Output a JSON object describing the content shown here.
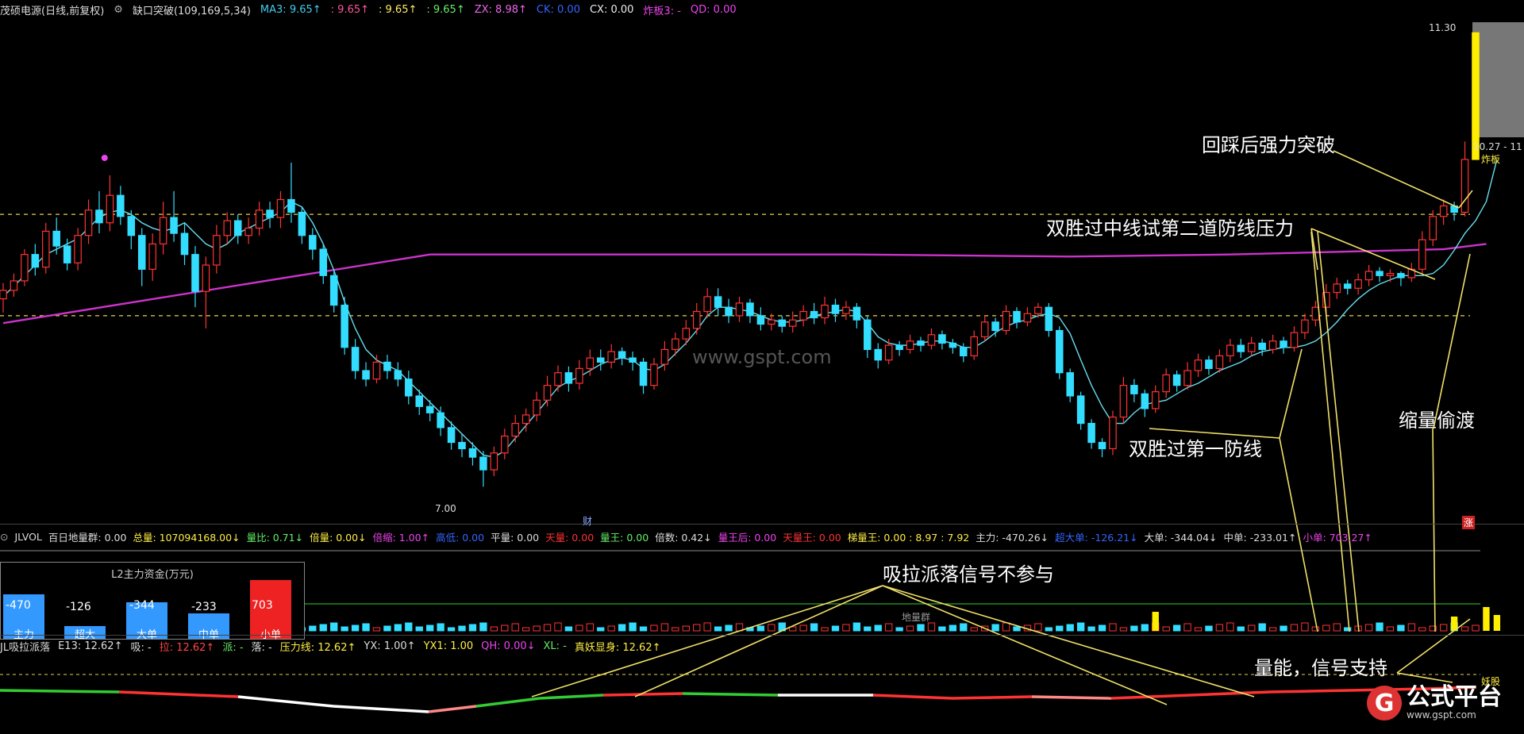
{
  "main_header": {
    "stock": "茂硕电源(日线,前复权)",
    "indicator": "缺口突破(109,169,5,34)",
    "ma3": "MA3: 9.65↑",
    "v2": ": 9.65↑",
    "v3": ": 9.65↑",
    "v4": ": 9.65↑",
    "zx": "ZX: 8.98↑",
    "ck": "CK: 0.00",
    "cx": "CX: 0.00",
    "zhaban": "炸板3: -",
    "qd": "QD: 0.00"
  },
  "vol_header": {
    "name": "JLVOL",
    "baidi": "百日地量群: 0.00",
    "zongliang": "总量: 107094168.00↓",
    "liangbi": "量比: 0.71↓",
    "beiliang": "倍量: 0.00↓",
    "beisuo": "倍缩: 1.00↑",
    "gaoliang": "高低: 0.00",
    "pingliang": "平量: 0.00",
    "tianliang": "天量: 0.00",
    "liangwang": "量王: 0.00",
    "beishu": "倍数: 0.42↓",
    "liangwanghou": "量王后: 0.00",
    "tianliangwang": "天量王: 0.00",
    "bangliangwang": "梯量王: 0.00 : 8.97 : 7.92",
    "zhuli": "主力: -470.26↓",
    "chaoda": "超大单: -126.21↓",
    "dadan": "大单: -344.04↓",
    "zhongdan": "中单: -233.01↑",
    "xiaodan": "小单: 703.27↑"
  },
  "ind_header": {
    "name": "JL吸拉派落",
    "e13": "E13: 12.62↑",
    "xi": "吸: -",
    "la": "拉: 12.62↑",
    "pai": "派: -",
    "luo": "落: -",
    "yalixian": "压力线: 12.62↑",
    "yx": "YX: 1.00↑",
    "yx1": "YX1: 1.00",
    "qh": "QH: 0.00↓",
    "xl": "XL: -",
    "zhenyao": "真妖显身: 12.62↑"
  },
  "price_labels": {
    "high": "11.30",
    "mid": "10.27 - 11",
    "zhaban_tag": "炸板",
    "low": "7.00",
    "cai": "财",
    "zhang": "涨",
    "yao": "妖股"
  },
  "annotations": {
    "a1": "回踩后强力突破",
    "a2": "双胜过中线试第二道防线压力",
    "a3": "缩量偷渡",
    "a4": "双胜过第一防线",
    "a5": "吸拉派落信号不参与",
    "a6": "量能，信号支持"
  },
  "l2": {
    "title": "L2主力资金(万元)",
    "bars": [
      {
        "label": "主力",
        "value": "-470",
        "num": -470
      },
      {
        "label": "超大",
        "value": "-126",
        "num": -126
      },
      {
        "label": "大单",
        "value": "-344",
        "num": -344
      },
      {
        "label": "中单",
        "value": "-233",
        "num": -233
      },
      {
        "label": "小单",
        "value": "703",
        "num": 703
      }
    ]
  },
  "dilianggun": "地量群",
  "watermark": "www.gspt.com",
  "logo": {
    "mark": "G",
    "name": "公式平台",
    "url": "www.gspt.com"
  },
  "colors": {
    "up": "#ff3333",
    "down": "#33ddff",
    "ma_slow": "#cc33cc",
    "ma_fast": "#66ddee",
    "dash": "#e8d24a",
    "annotation_line": "#f0e068"
  },
  "chart_data": {
    "type": "candlestick",
    "ylim": [
      6.8,
      11.4
    ],
    "candles": [
      [
        8.78,
        8.86,
        8.65,
        8.93
      ],
      [
        8.86,
        8.95,
        8.8,
        9.02
      ],
      [
        8.95,
        9.2,
        8.9,
        9.25
      ],
      [
        9.2,
        9.08,
        9.0,
        9.3
      ],
      [
        9.08,
        9.42,
        9.02,
        9.5
      ],
      [
        9.42,
        9.28,
        9.2,
        9.55
      ],
      [
        9.28,
        9.12,
        9.05,
        9.35
      ],
      [
        9.12,
        9.38,
        9.05,
        9.45
      ],
      [
        9.38,
        9.62,
        9.3,
        9.72
      ],
      [
        9.62,
        9.5,
        9.4,
        9.8
      ],
      [
        9.5,
        9.76,
        9.42,
        9.95
      ],
      [
        9.76,
        9.56,
        9.48,
        9.85
      ],
      [
        9.56,
        9.38,
        9.25,
        9.62
      ],
      [
        9.38,
        9.06,
        8.9,
        9.45
      ],
      [
        9.06,
        9.3,
        8.95,
        9.4
      ],
      [
        9.3,
        9.55,
        9.2,
        9.7
      ],
      [
        9.55,
        9.4,
        9.32,
        9.8
      ],
      [
        9.4,
        9.2,
        9.1,
        9.5
      ],
      [
        9.2,
        8.85,
        8.7,
        9.28
      ],
      [
        8.85,
        9.1,
        8.5,
        9.18
      ],
      [
        9.1,
        9.38,
        9.02,
        9.48
      ],
      [
        9.38,
        9.52,
        9.3,
        9.6
      ],
      [
        9.52,
        9.38,
        9.3,
        9.58
      ],
      [
        9.38,
        9.45,
        9.3,
        9.55
      ],
      [
        9.45,
        9.62,
        9.38,
        9.7
      ],
      [
        9.62,
        9.55,
        9.45,
        9.7
      ],
      [
        9.55,
        9.72,
        9.45,
        9.8
      ],
      [
        9.72,
        9.6,
        9.5,
        10.07
      ],
      [
        9.6,
        9.38,
        9.3,
        9.65
      ],
      [
        9.38,
        9.25,
        9.15,
        9.45
      ],
      [
        9.25,
        9.0,
        8.92,
        9.3
      ],
      [
        9.0,
        8.72,
        8.65,
        9.05
      ],
      [
        8.72,
        8.32,
        8.25,
        8.8
      ],
      [
        8.32,
        8.1,
        8.02,
        8.4
      ],
      [
        8.1,
        8.02,
        7.95,
        8.18
      ],
      [
        8.02,
        8.18,
        7.98,
        8.25
      ],
      [
        8.18,
        8.1,
        8.02,
        8.25
      ],
      [
        8.1,
        8.02,
        7.95,
        8.18
      ],
      [
        8.02,
        7.86,
        7.78,
        8.1
      ],
      [
        7.86,
        7.76,
        7.68,
        7.92
      ],
      [
        7.76,
        7.7,
        7.62,
        7.82
      ],
      [
        7.7,
        7.56,
        7.48,
        7.76
      ],
      [
        7.56,
        7.42,
        7.35,
        7.62
      ],
      [
        7.42,
        7.36,
        7.28,
        7.5
      ],
      [
        7.36,
        7.28,
        7.2,
        7.42
      ],
      [
        7.28,
        7.16,
        7.0,
        7.34
      ],
      [
        7.16,
        7.32,
        7.1,
        7.38
      ],
      [
        7.32,
        7.48,
        7.26,
        7.55
      ],
      [
        7.48,
        7.6,
        7.42,
        7.68
      ],
      [
        7.6,
        7.68,
        7.52,
        7.74
      ],
      [
        7.68,
        7.82,
        7.62,
        7.9
      ],
      [
        7.82,
        7.96,
        7.76,
        8.05
      ],
      [
        7.96,
        8.08,
        7.9,
        8.15
      ],
      [
        8.08,
        7.98,
        7.9,
        8.14
      ],
      [
        7.98,
        8.12,
        7.92,
        8.2
      ],
      [
        8.12,
        8.22,
        8.05,
        8.3
      ],
      [
        8.22,
        8.18,
        8.1,
        8.3
      ],
      [
        8.18,
        8.28,
        8.12,
        8.35
      ],
      [
        8.28,
        8.22,
        8.15,
        8.32
      ],
      [
        8.22,
        8.18,
        8.1,
        8.28
      ],
      [
        8.18,
        7.96,
        7.88,
        8.22
      ],
      [
        7.96,
        8.16,
        7.92,
        8.22
      ],
      [
        8.16,
        8.3,
        8.1,
        8.38
      ],
      [
        8.3,
        8.4,
        8.24,
        8.46
      ],
      [
        8.4,
        8.5,
        8.34,
        8.58
      ],
      [
        8.5,
        8.66,
        8.44,
        8.74
      ],
      [
        8.66,
        8.8,
        8.6,
        8.88
      ],
      [
        8.8,
        8.7,
        8.62,
        8.88
      ],
      [
        8.7,
        8.62,
        8.55,
        8.78
      ],
      [
        8.62,
        8.74,
        8.56,
        8.8
      ],
      [
        8.74,
        8.62,
        8.55,
        8.78
      ],
      [
        8.62,
        8.54,
        8.48,
        8.7
      ],
      [
        8.54,
        8.58,
        8.48,
        8.64
      ],
      [
        8.58,
        8.52,
        8.46,
        8.62
      ],
      [
        8.52,
        8.58,
        8.46,
        8.66
      ],
      [
        8.58,
        8.66,
        8.52,
        8.72
      ],
      [
        8.66,
        8.6,
        8.54,
        8.74
      ],
      [
        8.6,
        8.72,
        8.54,
        8.8
      ],
      [
        8.72,
        8.64,
        8.56,
        8.78
      ],
      [
        8.64,
        8.7,
        8.58,
        8.76
      ],
      [
        8.7,
        8.58,
        8.5,
        8.74
      ],
      [
        8.58,
        8.3,
        8.22,
        8.62
      ],
      [
        8.3,
        8.2,
        8.12,
        8.36
      ],
      [
        8.2,
        8.34,
        8.16,
        8.4
      ],
      [
        8.34,
        8.3,
        8.24,
        8.38
      ],
      [
        8.3,
        8.38,
        8.26,
        8.44
      ],
      [
        8.38,
        8.34,
        8.28,
        8.42
      ],
      [
        8.34,
        8.44,
        8.3,
        8.5
      ],
      [
        8.44,
        8.36,
        8.3,
        8.48
      ],
      [
        8.36,
        8.32,
        8.26,
        8.4
      ],
      [
        8.32,
        8.24,
        8.18,
        8.36
      ],
      [
        8.24,
        8.42,
        8.2,
        8.48
      ],
      [
        8.42,
        8.56,
        8.38,
        8.62
      ],
      [
        8.56,
        8.48,
        8.42,
        8.6
      ],
      [
        8.48,
        8.66,
        8.44,
        8.72
      ],
      [
        8.66,
        8.56,
        8.5,
        8.7
      ],
      [
        8.56,
        8.64,
        8.52,
        8.7
      ],
      [
        8.64,
        8.7,
        8.6,
        8.74
      ],
      [
        8.7,
        8.48,
        8.42,
        8.74
      ],
      [
        8.48,
        8.08,
        8.02,
        8.52
      ],
      [
        8.08,
        7.86,
        7.8,
        8.12
      ],
      [
        7.86,
        7.6,
        7.54,
        7.9
      ],
      [
        7.6,
        7.42,
        7.36,
        7.64
      ],
      [
        7.42,
        7.36,
        7.28,
        7.46
      ],
      [
        7.36,
        7.66,
        7.3,
        7.72
      ],
      [
        7.66,
        7.96,
        7.6,
        8.04
      ],
      [
        7.96,
        7.88,
        7.8,
        8.02
      ],
      [
        7.88,
        7.74,
        7.66,
        7.92
      ],
      [
        7.74,
        7.9,
        7.7,
        7.96
      ],
      [
        7.9,
        8.06,
        7.84,
        8.12
      ],
      [
        8.06,
        7.96,
        7.9,
        8.1
      ],
      [
        7.96,
        8.1,
        7.92,
        8.18
      ],
      [
        8.1,
        8.2,
        8.04,
        8.26
      ],
      [
        8.2,
        8.12,
        8.06,
        8.24
      ],
      [
        8.12,
        8.24,
        8.08,
        8.3
      ],
      [
        8.24,
        8.34,
        8.18,
        8.4
      ],
      [
        8.34,
        8.28,
        8.22,
        8.4
      ],
      [
        8.28,
        8.36,
        8.24,
        8.42
      ],
      [
        8.36,
        8.3,
        8.24,
        8.4
      ],
      [
        8.3,
        8.38,
        8.26,
        8.44
      ],
      [
        8.38,
        8.32,
        8.26,
        8.42
      ],
      [
        8.32,
        8.46,
        8.28,
        8.52
      ],
      [
        8.46,
        8.58,
        8.4,
        8.64
      ],
      [
        8.58,
        8.7,
        8.52,
        8.76
      ],
      [
        8.7,
        8.84,
        8.64,
        8.92
      ],
      [
        8.84,
        8.92,
        8.78,
        8.98
      ],
      [
        8.92,
        8.88,
        8.82,
        8.96
      ],
      [
        8.88,
        8.96,
        8.82,
        9.02
      ],
      [
        8.96,
        9.04,
        8.9,
        9.1
      ],
      [
        9.04,
        9.0,
        8.94,
        9.08
      ],
      [
        9.0,
        9.02,
        8.94,
        9.06
      ],
      [
        9.02,
        8.98,
        8.9,
        9.04
      ],
      [
        8.98,
        9.06,
        8.94,
        9.12
      ],
      [
        9.06,
        9.34,
        9.02,
        9.42
      ],
      [
        9.34,
        9.56,
        9.28,
        9.62
      ],
      [
        9.56,
        9.66,
        9.48,
        9.72
      ],
      [
        9.66,
        9.6,
        9.52,
        9.7
      ],
      [
        9.6,
        10.1,
        9.56,
        10.27
      ],
      [
        10.1,
        11.3,
        10.1,
        11.3
      ]
    ],
    "ma_fast": [
      8.8,
      8.9,
      9.0,
      9.1,
      9.2,
      9.25,
      9.3,
      9.35,
      9.45,
      9.55,
      9.6,
      9.62,
      9.58,
      9.5,
      9.45,
      9.42,
      9.45,
      9.5,
      9.4,
      9.3,
      9.25,
      9.3,
      9.4,
      9.45,
      9.5,
      9.55,
      9.6,
      9.7,
      9.65,
      9.5,
      9.3,
      9.05,
      8.75,
      8.5,
      8.3,
      8.2,
      8.15,
      8.1,
      8.0,
      7.9,
      7.8,
      7.7,
      7.6,
      7.5,
      7.4,
      7.3,
      7.28,
      7.34,
      7.46,
      7.58,
      7.7,
      7.82,
      7.94,
      8.0,
      8.04,
      8.1,
      8.16,
      8.2,
      8.22,
      8.2,
      8.12,
      8.1,
      8.16,
      8.26,
      8.36,
      8.48,
      8.62,
      8.7,
      8.7,
      8.68,
      8.66,
      8.62,
      8.58,
      8.56,
      8.56,
      8.58,
      8.62,
      8.64,
      8.66,
      8.68,
      8.66,
      8.55,
      8.42,
      8.36,
      8.34,
      8.34,
      8.36,
      8.38,
      8.38,
      8.36,
      8.32,
      8.32,
      8.38,
      8.46,
      8.52,
      8.56,
      8.58,
      8.62,
      8.64,
      8.6,
      8.45,
      8.2,
      7.96,
      7.76,
      7.6,
      7.6,
      7.7,
      7.78,
      7.8,
      7.82,
      7.88,
      7.94,
      7.98,
      8.04,
      8.1,
      8.14,
      8.18,
      8.24,
      8.28,
      8.3,
      8.32,
      8.32,
      8.34,
      8.38,
      8.46,
      8.56,
      8.68,
      8.78,
      8.86,
      8.92,
      8.96,
      9.0,
      9.0,
      9.0,
      9.02,
      9.1,
      9.24,
      9.4,
      9.52,
      9.7,
      10.1
    ],
    "ma_slow": {
      "x": [
        0,
        40,
        80,
        100,
        115,
        135,
        139
      ],
      "y": [
        8.55,
        9.2,
        9.2,
        9.18,
        9.2,
        9.25,
        9.3
      ]
    }
  }
}
